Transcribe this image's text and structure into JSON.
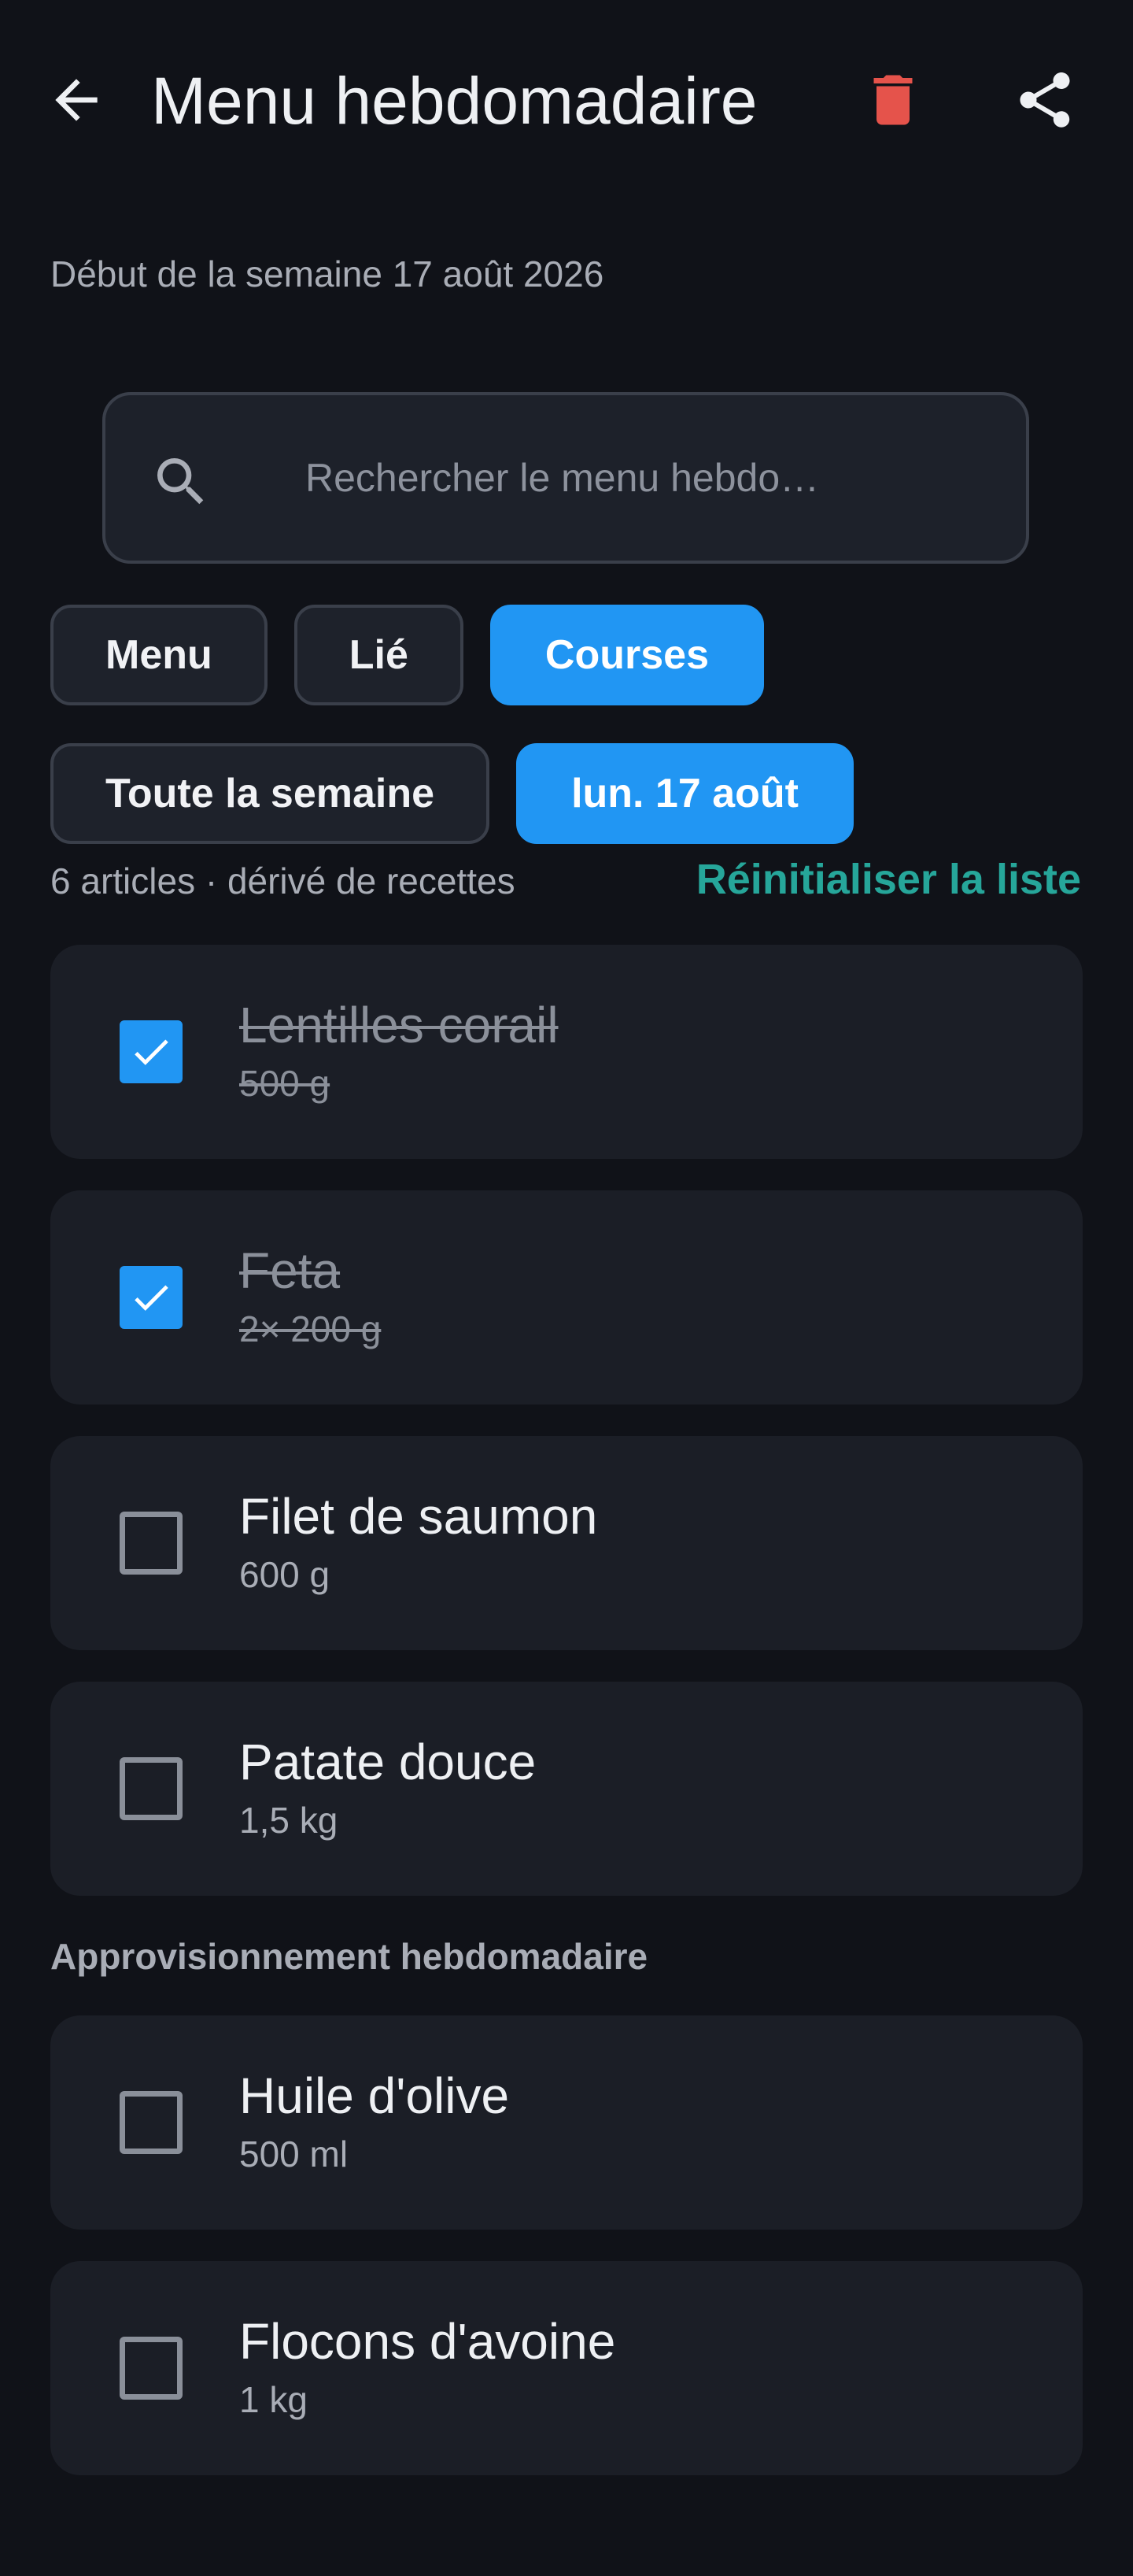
{
  "header": {
    "title": "Menu hebdomadaire",
    "back_icon": "arrow-left-icon",
    "delete_icon": "trash-icon",
    "share_icon": "share-icon",
    "delete_color": "#e5534b"
  },
  "week_start": "Début de la semaine 17 août 2026",
  "search": {
    "placeholder": "Rechercher le menu hebdo…",
    "value": ""
  },
  "tabs": [
    {
      "label": "Menu",
      "active": false
    },
    {
      "label": "Lié",
      "active": false
    },
    {
      "label": "Courses",
      "active": true
    }
  ],
  "day_filters": [
    {
      "label": "Toute la semaine",
      "active": false
    },
    {
      "label": "lun. 17 août",
      "active": true
    }
  ],
  "summary": "6 articles · dérivé de recettes",
  "reset_label": "Réinitialiser la liste",
  "items": [
    {
      "name": "Lentilles corail",
      "qty": "500 g",
      "checked": true
    },
    {
      "name": "Feta",
      "qty": "2× 200 g",
      "checked": true
    },
    {
      "name": "Filet de saumon",
      "qty": "600 g",
      "checked": false
    },
    {
      "name": "Patate douce",
      "qty": "1,5 kg",
      "checked": false
    }
  ],
  "weekly_section": {
    "title": "Approvisionnement hebdomadaire",
    "items": [
      {
        "name": "Huile d'olive",
        "qty": "500 ml",
        "checked": false
      },
      {
        "name": "Flocons d'avoine",
        "qty": "1 kg",
        "checked": false
      }
    ]
  },
  "colors": {
    "background": "#101218",
    "card": "#1b1e26",
    "accent": "#2196f3",
    "link": "#26a69a"
  }
}
